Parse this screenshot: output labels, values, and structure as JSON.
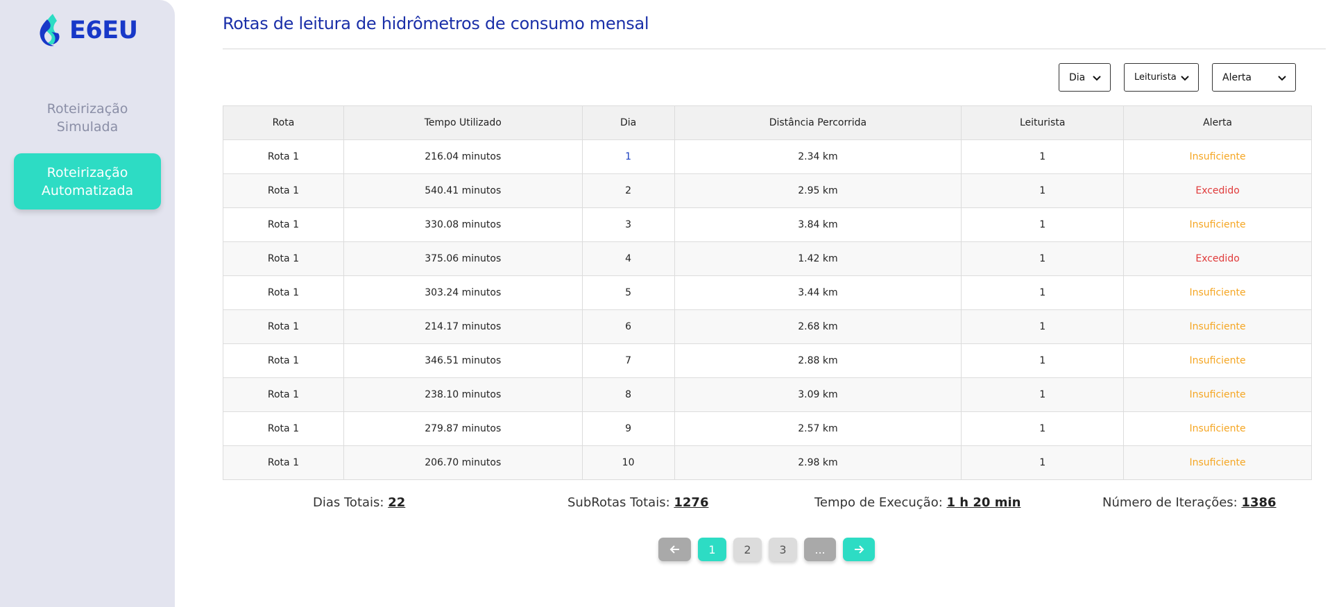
{
  "brand": {
    "name": "E6EU"
  },
  "sidebar": {
    "items": [
      {
        "label_line1": "Roteirização",
        "label_line2": "Simulada",
        "active": false
      },
      {
        "label_line1": "Roteirização",
        "label_line2": "Automatizada",
        "active": true
      }
    ]
  },
  "header": {
    "title": "Rotas de leitura de hidrômetros de consumo mensal"
  },
  "filters": {
    "dia": "Dia",
    "leiturista": "Leiturista",
    "alerta": "Alerta"
  },
  "table": {
    "columns": [
      "Rota",
      "Tempo Utilizado",
      "Dia",
      "Distância Percorrida",
      "Leiturista",
      "Alerta"
    ],
    "rows": [
      [
        "Rota 1",
        "216.04 minutos",
        "1",
        "2.34 km",
        "1",
        "Insuficiente"
      ],
      [
        "Rota 1",
        "540.41 minutos",
        "2",
        "2.95 km",
        "1",
        "Excedido"
      ],
      [
        "Rota 1",
        "330.08 minutos",
        "3",
        "3.84 km",
        "1",
        "Insuficiente"
      ],
      [
        "Rota 1",
        "375.06 minutos",
        "4",
        "1.42 km",
        "1",
        "Excedido"
      ],
      [
        "Rota 1",
        "303.24 minutos",
        "5",
        "3.44 km",
        "1",
        "Insuficiente"
      ],
      [
        "Rota 1",
        "214.17 minutos",
        "6",
        "2.68 km",
        "1",
        "Insuficiente"
      ],
      [
        "Rota 1",
        "346.51 minutos",
        "7",
        "2.88 km",
        "1",
        "Insuficiente"
      ],
      [
        "Rota 1",
        "238.10 minutos",
        "8",
        "3.09 km",
        "1",
        "Insuficiente"
      ],
      [
        "Rota 1",
        "279.87 minutos",
        "9",
        "2.57 km",
        "1",
        "Insuficiente"
      ],
      [
        "Rota 1",
        "206.70 minutos",
        "10",
        "2.98 km",
        "1",
        "Insuficiente"
      ]
    ]
  },
  "stats": {
    "dias_label": "Dias Totais:",
    "dias_value": "22",
    "subrotas_label": "SubRotas Totais:",
    "subrotas_value": "1276",
    "tempo_label": "Tempo de Execução:",
    "tempo_value": "1 h 20 min",
    "iter_label": "Número de Iterações:",
    "iter_value": "1386"
  },
  "pagination": {
    "pages": [
      "1",
      "2",
      "3"
    ],
    "ellipsis": "...",
    "current": "1"
  },
  "colors": {
    "accent": "#2ddcc4",
    "brand": "#1838c8",
    "title": "#1a2fa8",
    "alert_insuficiente": "#f5a623",
    "alert_excedido": "#e03a3a",
    "sidebar_bg": "#e3e4ef"
  },
  "icons": {
    "logo": "water-drop-logo-icon",
    "prev": "arrow-left-icon",
    "next": "arrow-right-icon",
    "dropdown": "chevron-down-icon"
  }
}
